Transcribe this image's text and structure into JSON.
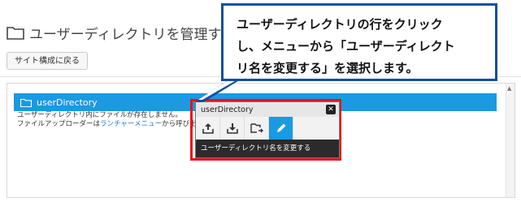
{
  "page": {
    "title": "ユーザーディレクトリを管理する"
  },
  "toolbar": {
    "back_label": "サイト構成に戻る"
  },
  "directory": {
    "name": "userDirectory"
  },
  "info": {
    "line1": "ユーザーディレクトリ内にファイルが存在しません。",
    "line2_prefix": "ファイルアップローダーは",
    "line2_link": "ランチャーメニュー",
    "line2_suffix": "から呼び出します"
  },
  "popup": {
    "title": "userDirectory",
    "caption": "ユーザーディレクトリ名を変更する",
    "tools": [
      {
        "icon": "upload-icon"
      },
      {
        "icon": "download-icon"
      },
      {
        "icon": "move-folder-icon"
      },
      {
        "icon": "rename-pencil-icon",
        "active": true
      }
    ]
  },
  "tooltip": {
    "lines": [
      "ユーザーディレクトリの行をクリック",
      "し、メニューから「ユーザーディレクト",
      "リ名を変更する」を選択します。"
    ]
  },
  "colors": {
    "accent": "#1a9ae0",
    "callout_border": "#e8121c",
    "tooltip_border": "#0f4f9e"
  }
}
